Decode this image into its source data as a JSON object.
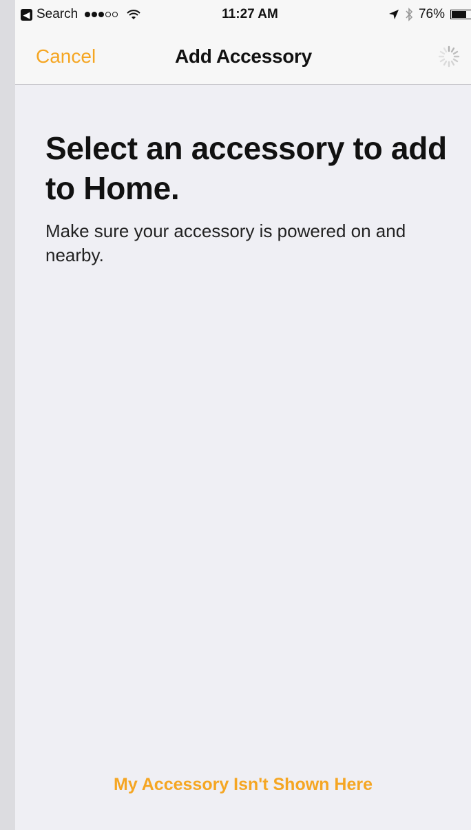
{
  "status_bar": {
    "back_app": "Search",
    "time": "11:27 AM",
    "battery_percent": "76%",
    "battery_level": 0.76,
    "signal_bars_filled": 3,
    "signal_bars_total": 5
  },
  "nav": {
    "cancel_label": "Cancel",
    "title": "Add Accessory"
  },
  "content": {
    "headline": "Select an accessory to add to Home.",
    "subtext": "Make sure your accessory is powered on and nearby."
  },
  "footer": {
    "link_label": "My Accessory Isn't Shown Here"
  },
  "colors": {
    "accent": "#f5a623",
    "background": "#efeff4",
    "bar": "#f7f7f7"
  }
}
